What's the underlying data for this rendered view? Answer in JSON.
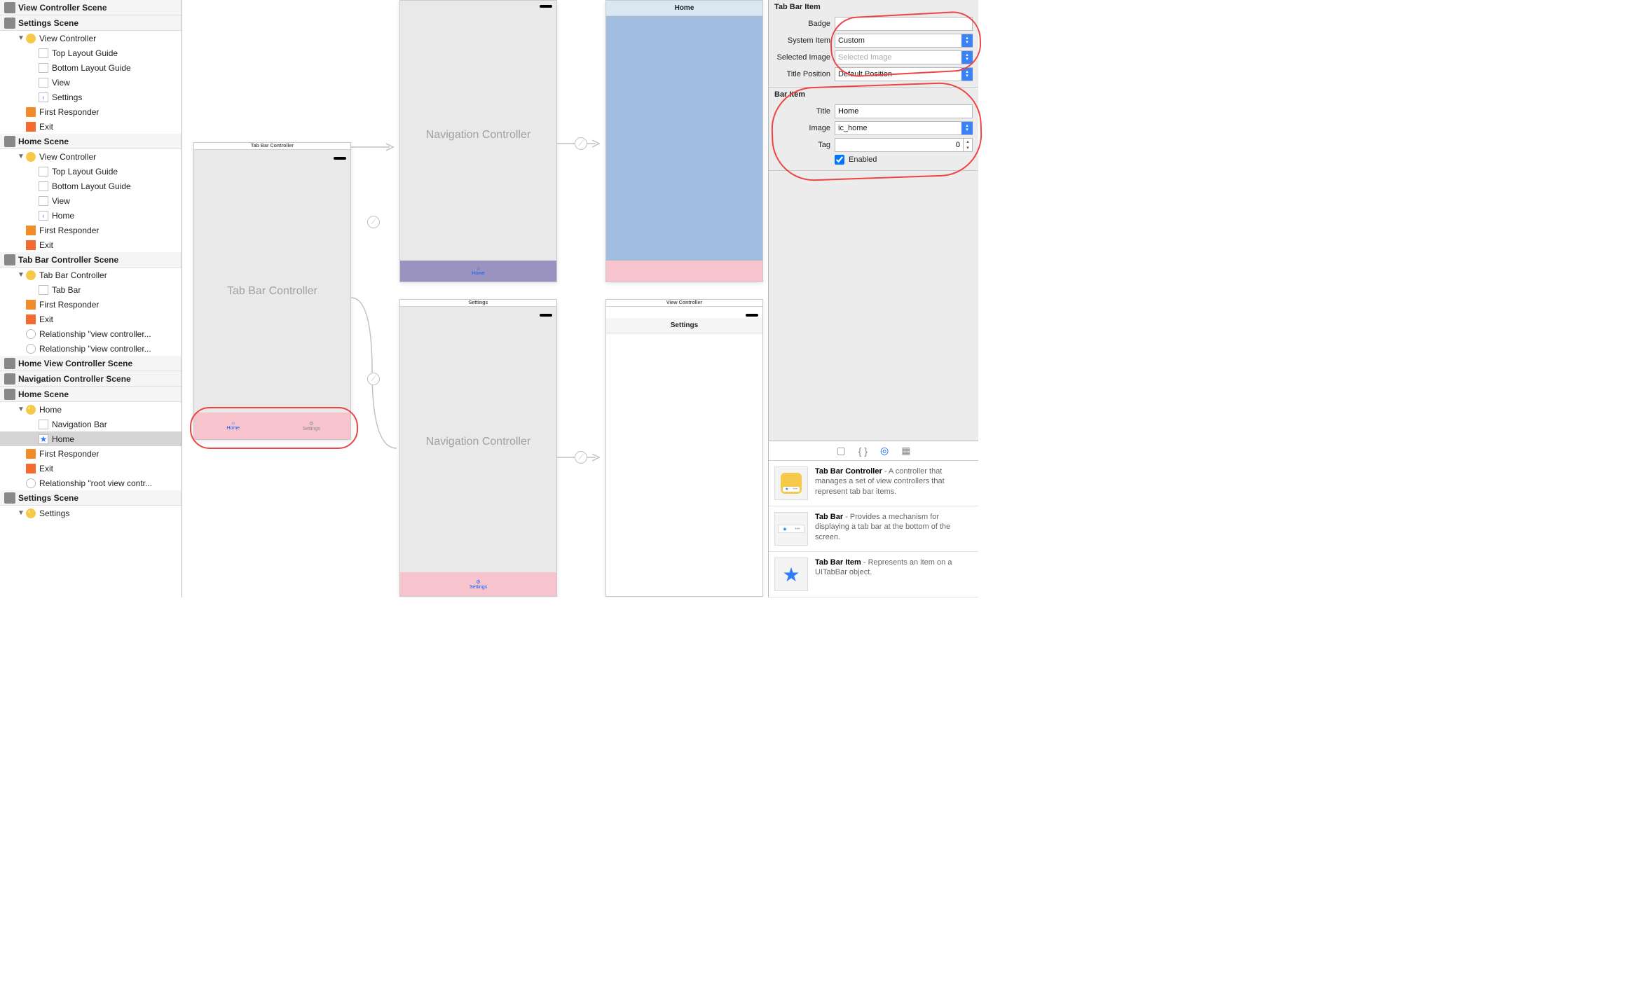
{
  "outline": {
    "scenes": [
      {
        "title": "View Controller Scene",
        "children": []
      },
      {
        "title": "Settings Scene",
        "children": [
          {
            "label": "View Controller",
            "icon": "vc",
            "indent": 1,
            "disc": "▼"
          },
          {
            "label": "Top Layout Guide",
            "icon": "box",
            "indent": 2
          },
          {
            "label": "Bottom Layout Guide",
            "icon": "box",
            "indent": 2
          },
          {
            "label": "View",
            "icon": "box",
            "indent": 2
          },
          {
            "label": "Settings",
            "icon": "back",
            "indent": 2
          },
          {
            "label": "First Responder",
            "icon": "cube",
            "indent": 1
          },
          {
            "label": "Exit",
            "icon": "exit",
            "indent": 1
          }
        ]
      },
      {
        "title": "Home Scene",
        "children": [
          {
            "label": "View Controller",
            "icon": "vc",
            "indent": 1,
            "disc": "▼"
          },
          {
            "label": "Top Layout Guide",
            "icon": "box",
            "indent": 2
          },
          {
            "label": "Bottom Layout Guide",
            "icon": "box",
            "indent": 2
          },
          {
            "label": "View",
            "icon": "box",
            "indent": 2
          },
          {
            "label": "Home",
            "icon": "back",
            "indent": 2
          },
          {
            "label": "First Responder",
            "icon": "cube",
            "indent": 1
          },
          {
            "label": "Exit",
            "icon": "exit",
            "indent": 1
          }
        ]
      },
      {
        "title": "Tab Bar Controller Scene",
        "children": [
          {
            "label": "Tab Bar Controller",
            "icon": "vclt",
            "indent": 1,
            "disc": "▼"
          },
          {
            "label": "Tab Bar",
            "icon": "box",
            "indent": 2
          },
          {
            "label": "First Responder",
            "icon": "cube",
            "indent": 1
          },
          {
            "label": "Exit",
            "icon": "exit",
            "indent": 1
          },
          {
            "label": "Relationship \"view controller...",
            "icon": "seg",
            "indent": 1
          },
          {
            "label": "Relationship \"view controller...",
            "icon": "seg",
            "indent": 1
          }
        ]
      },
      {
        "title": "Home View Controller Scene",
        "children": []
      },
      {
        "title": "Navigation Controller Scene",
        "children": []
      },
      {
        "title": "Home Scene",
        "children": [
          {
            "label": "Home",
            "icon": "backy",
            "indent": 1,
            "disc": "▼"
          },
          {
            "label": "Navigation Bar",
            "icon": "nav",
            "indent": 2
          },
          {
            "label": "Home",
            "icon": "star",
            "indent": 2,
            "selected": true
          },
          {
            "label": "First Responder",
            "icon": "cube",
            "indent": 1
          },
          {
            "label": "Exit",
            "icon": "exit",
            "indent": 1
          },
          {
            "label": "Relationship \"root view contr...",
            "icon": "seg",
            "indent": 1
          }
        ]
      },
      {
        "title": "Settings Scene",
        "children": [
          {
            "label": "Settings",
            "icon": "backy",
            "indent": 1,
            "disc": "▼",
            "cut": true
          }
        ]
      }
    ]
  },
  "canvas": {
    "tabBarController": {
      "barTitle": "Tab Bar Controller",
      "bodyTitle": "Tab Bar Controller",
      "tabs": [
        {
          "label": "Home",
          "active": true,
          "icon": "home"
        },
        {
          "label": "Settings",
          "active": false,
          "icon": "gear"
        }
      ]
    },
    "navHome": {
      "bodyTitle": "Navigation Controller",
      "tabLabel": "Home"
    },
    "navSettings": {
      "barTitle": "Settings",
      "bodyTitle": "Navigation Controller",
      "tabLabel": "Settings"
    },
    "homeVC": {
      "navTitle": "Home"
    },
    "settingsVC": {
      "barTitle": "View Controller",
      "navTitle": "Settings"
    }
  },
  "inspector": {
    "tabBarItem": {
      "header": "Tab Bar Item",
      "badgeLabel": "Badge",
      "badgeValue": "",
      "systemItemLabel": "System Item",
      "systemItemValue": "Custom",
      "selectedImageLabel": "Selected Image",
      "selectedImagePlaceholder": "Selected Image",
      "titlePositionLabel": "Title Position",
      "titlePositionValue": "Default Position"
    },
    "barItem": {
      "header": "Bar Item",
      "titleLabel": "Title",
      "titleValue": "Home",
      "imageLabel": "Image",
      "imageValue": "ic_home",
      "tagLabel": "Tag",
      "tagValue": "0",
      "enabledLabel": "Enabled",
      "enabledChecked": true
    },
    "library": {
      "items": [
        {
          "title": "Tab Bar Controller",
          "desc": " - A controller that manages a set of view controllers that represent tab bar items.",
          "icon": "tbc"
        },
        {
          "title": "Tab Bar",
          "desc": " - Provides a mechanism for displaying a tab bar at the bottom of the screen.",
          "icon": "tb"
        },
        {
          "title": "Tab Bar Item",
          "desc": " - Represents an item on a UITabBar object.",
          "icon": "tbi"
        }
      ]
    }
  }
}
